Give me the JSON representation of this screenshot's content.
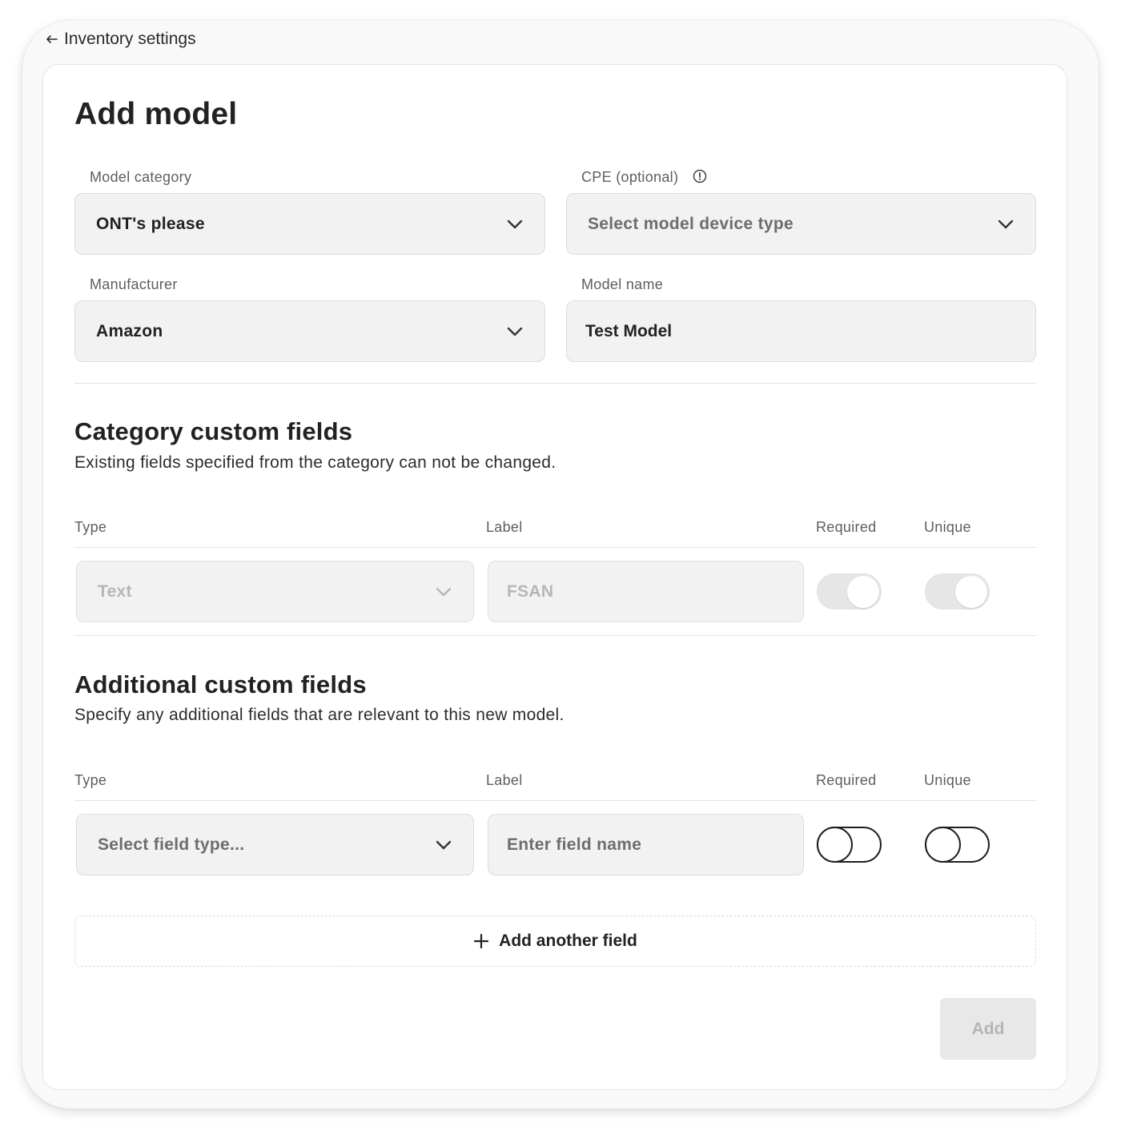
{
  "nav": {
    "back_label": "Inventory settings"
  },
  "page": {
    "title": "Add model"
  },
  "form": {
    "model_category": {
      "label": "Model category",
      "value": "ONT's please"
    },
    "cpe": {
      "label": "CPE (optional)",
      "placeholder": "Select model device type"
    },
    "manufacturer": {
      "label": "Manufacturer",
      "value": "Amazon"
    },
    "model_name": {
      "label": "Model name",
      "value": "Test Model"
    }
  },
  "category_fields": {
    "title": "Category custom fields",
    "description": "Existing fields specified from the category can not be changed.",
    "columns": {
      "type": "Type",
      "label": "Label",
      "required": "Required",
      "unique": "Unique"
    },
    "rows": [
      {
        "type": "Text",
        "label": "FSAN",
        "required": true,
        "unique": true,
        "disabled": true
      }
    ]
  },
  "additional_fields": {
    "title": "Additional custom fields",
    "description": "Specify any additional fields that are relevant to this new model.",
    "columns": {
      "type": "Type",
      "label": "Label",
      "required": "Required",
      "unique": "Unique"
    },
    "rows": [
      {
        "type_placeholder": "Select field type...",
        "label_placeholder": "Enter field name",
        "required": false,
        "unique": false
      }
    ],
    "add_button_label": "Add another field"
  },
  "actions": {
    "submit_label": "Add"
  },
  "icons": {
    "back": "arrow-left-icon",
    "chevron": "chevron-down-icon",
    "info": "info-icon",
    "plus": "plus-icon"
  },
  "colors": {
    "frame_bg": "#f9f9f9",
    "card_bg": "#ffffff",
    "input_bg": "#f2f2f2",
    "text_primary": "#222222",
    "text_muted": "#5e5e5e",
    "disabled_text": "#b6b6b6",
    "submit_disabled_bg": "#e8e8e8"
  }
}
